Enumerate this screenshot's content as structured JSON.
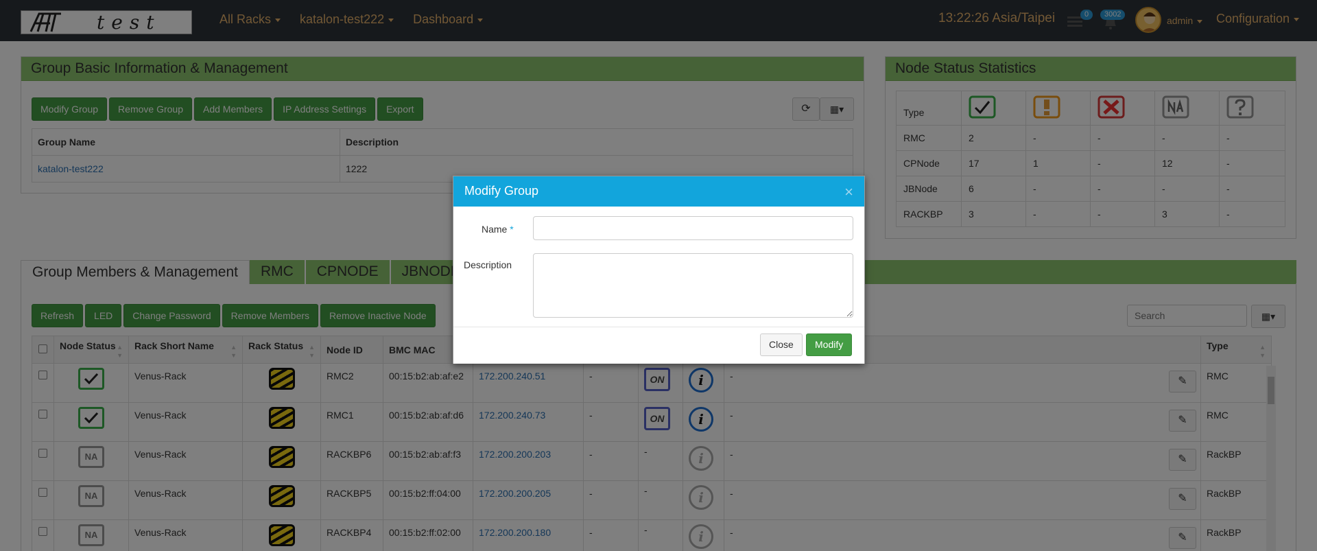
{
  "topbar": {
    "logo_text": "test",
    "nav": [
      "All Racks",
      "katalon-test222",
      "Dashboard"
    ],
    "clock": "13:22:26 Asia/Taipei",
    "list_badge": "0",
    "alert_badge": "3002",
    "user": "admin",
    "config": "Configuration"
  },
  "group_panel": {
    "title": "Group Basic Information & Management",
    "buttons": [
      "Modify Group",
      "Remove Group",
      "Add Members",
      "IP Address Settings",
      "Export"
    ],
    "columns": [
      "Group Name",
      "Description"
    ],
    "row": {
      "name": "katalon-test222",
      "description": "1222"
    }
  },
  "stats_panel": {
    "title": "Node Status Statistics",
    "type_header": "Type",
    "rows": [
      {
        "type": "RMC",
        "values": [
          "2",
          "-",
          "-",
          "-",
          "-"
        ]
      },
      {
        "type": "CPNode",
        "values": [
          "17",
          "1",
          "-",
          "12",
          "-"
        ]
      },
      {
        "type": "JBNode",
        "values": [
          "6",
          "-",
          "-",
          "-",
          "-"
        ]
      },
      {
        "type": "RACKBP",
        "values": [
          "3",
          "-",
          "-",
          "3",
          "-"
        ]
      }
    ]
  },
  "members": {
    "tabs": [
      "Group Members & Management",
      "RMC",
      "CPNODE",
      "JBNODE"
    ],
    "buttons": [
      "Refresh",
      "LED",
      "Change Password",
      "Remove Members",
      "Remove Inactive Node"
    ],
    "search_placeholder": "Search",
    "columns": [
      "Node Status",
      "Rack Short Name",
      "Rack Status",
      "Node ID",
      "BMC MAC",
      "Type"
    ],
    "rows": [
      {
        "status": "ok",
        "rack": "Venus-Rack",
        "node_id": "RMC2",
        "mac": "00:15:b2:ab:af:e2",
        "ip": "172.200.240.51",
        "c1": "-",
        "power": "ON",
        "info": "active",
        "note": "-",
        "type": "RMC"
      },
      {
        "status": "ok",
        "rack": "Venus-Rack",
        "node_id": "RMC1",
        "mac": "00:15:b2:ab:af:d6",
        "ip": "172.200.240.73",
        "c1": "-",
        "power": "ON",
        "info": "active",
        "note": "-",
        "type": "RMC"
      },
      {
        "status": "na",
        "rack": "Venus-Rack",
        "node_id": "RACKBP6",
        "mac": "00:15:b2:ab:af:f3",
        "ip": "172.200.200.203",
        "c1": "-",
        "power": "-",
        "info": "inactive",
        "note": "-",
        "type": "RackBP"
      },
      {
        "status": "na",
        "rack": "Venus-Rack",
        "node_id": "RACKBP5",
        "mac": "00:15:b2:ff:04:00",
        "ip": "172.200.200.205",
        "c1": "-",
        "power": "-",
        "info": "inactive",
        "note": "-",
        "type": "RackBP"
      },
      {
        "status": "na",
        "rack": "Venus-Rack",
        "node_id": "RACKBP4",
        "mac": "00:15:b2:ff:02:00",
        "ip": "172.200.200.180",
        "c1": "-",
        "power": "-",
        "info": "inactive",
        "note": "-",
        "type": "RackBP"
      }
    ]
  },
  "modal": {
    "title": "Modify Group",
    "close_x": "×",
    "name_label": "Name",
    "required_mark": "*",
    "name_value": "",
    "description_label": "Description",
    "description_value": "",
    "close_button": "Close",
    "modify_button": "Modify"
  },
  "colors": {
    "nav_text": "#e4b06a",
    "panel_head": "#8dc46f",
    "button_green": "#449d44",
    "modal_head": "#12a5dc"
  },
  "icons": [
    "list-icon",
    "bell-icon",
    "refresh-icon",
    "grid-columns-icon",
    "check-status-icon",
    "warning-status-icon",
    "error-status-icon",
    "na-status-icon",
    "unknown-status-icon",
    "rack-icon",
    "power-on-icon",
    "info-icon",
    "pencil-icon"
  ]
}
